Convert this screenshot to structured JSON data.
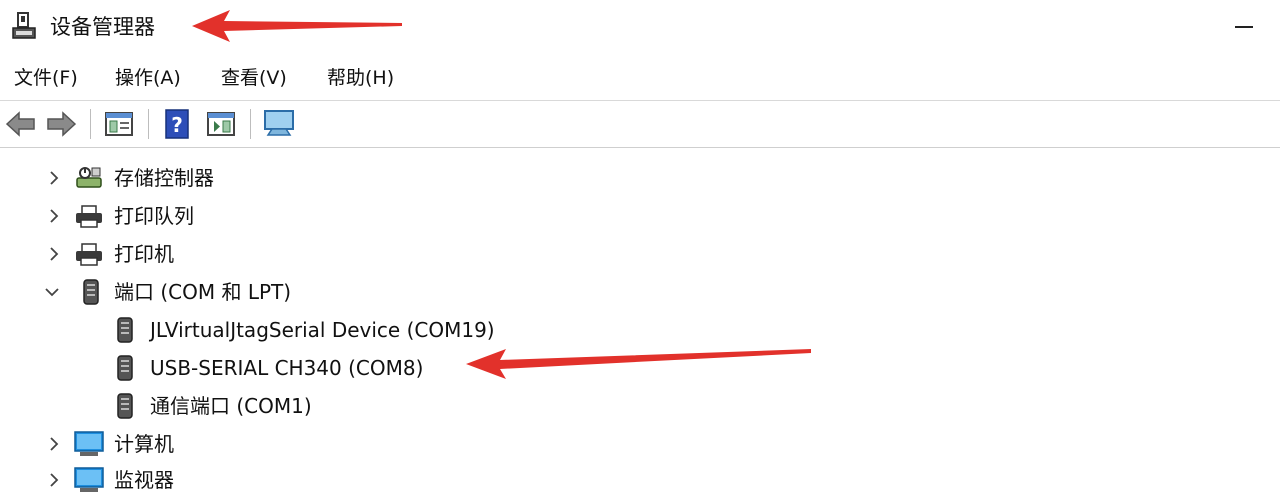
{
  "window": {
    "title": "设备管理器"
  },
  "menu": [
    {
      "label": "文件(F)"
    },
    {
      "label": "操作(A)"
    },
    {
      "label": "查看(V)"
    },
    {
      "label": "帮助(H)"
    }
  ],
  "toolbar": {
    "buttons": [
      "back-arrow-icon",
      "forward-arrow-icon",
      "show-hide-console-tree-icon",
      "help-icon",
      "show-action-pane-icon",
      "monitor-scan-icon"
    ]
  },
  "tree": {
    "items": [
      {
        "label": "存储控制器",
        "expanded": false,
        "icon": "storage-controller-icon"
      },
      {
        "label": "打印队列",
        "expanded": false,
        "icon": "printer-icon"
      },
      {
        "label": "打印机",
        "expanded": false,
        "icon": "printer-icon"
      },
      {
        "label": "端口 (COM 和 LPT)",
        "expanded": true,
        "icon": "port-icon",
        "children": [
          {
            "label": "JLVirtualJtagSerial Device (COM19)",
            "icon": "port-icon"
          },
          {
            "label": "USB-SERIAL CH340 (COM8)",
            "icon": "port-icon"
          },
          {
            "label": "通信端口 (COM1)",
            "icon": "port-icon"
          }
        ]
      },
      {
        "label": "计算机",
        "expanded": false,
        "icon": "monitor-icon"
      },
      {
        "label": "监视器",
        "expanded": false,
        "icon": "monitor-icon"
      }
    ]
  },
  "colors": {
    "annotation_arrow": "#e2312b",
    "monitor_blue": "#1e8fe0"
  }
}
